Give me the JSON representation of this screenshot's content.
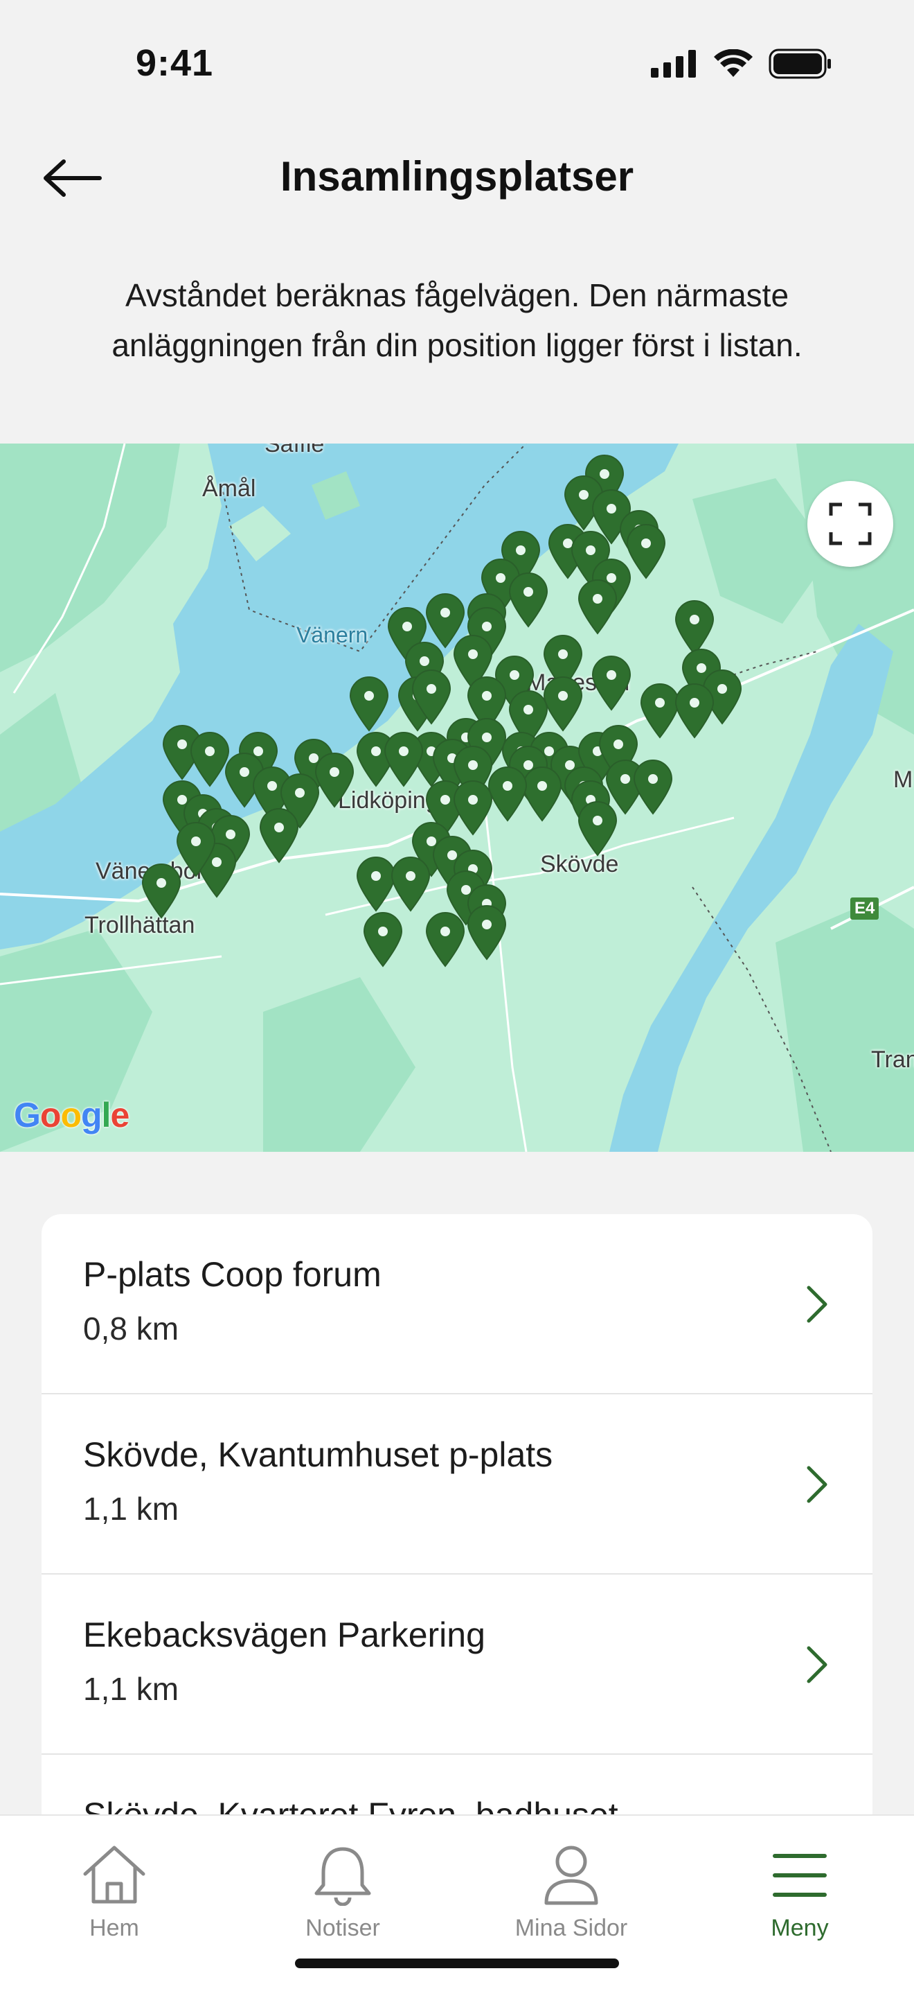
{
  "status_bar": {
    "time": "9:41"
  },
  "header": {
    "title": "Insamlingsplatser"
  },
  "intro_text": "Avståndet beräknas fågelvägen. Den närmaste anläggningen från din position ligger först i listan.",
  "map": {
    "labels": {
      "saffle": "Säffle",
      "amal": "Åmål",
      "vanern": "Vänern",
      "mariestad": "Mariestad",
      "lidkoping": "Lidköping",
      "vanersborg": "Vänersborg",
      "trollhattan": "Trollhättan",
      "skovde": "Skövde",
      "m_city": "M",
      "tran": "Tran",
      "e4": "E4"
    },
    "attribution": "Google",
    "pin_color": "#2e6f2e"
  },
  "list": {
    "items": [
      {
        "name": "P-plats Coop forum",
        "distance": "0,8 km"
      },
      {
        "name": "Skövde, Kvantumhuset p-plats",
        "distance": "1,1 km"
      },
      {
        "name": "Ekebacksvägen Parkering",
        "distance": "1,1 km"
      },
      {
        "name": "Skövde, Kvarteret Fyren, badhuset",
        "distance": ""
      }
    ]
  },
  "tabs": [
    {
      "label": "Hem",
      "icon": "home-icon"
    },
    {
      "label": "Notiser",
      "icon": "bell-icon"
    },
    {
      "label": "Mina Sidor",
      "icon": "user-icon"
    },
    {
      "label": "Meny",
      "icon": "menu-icon"
    }
  ],
  "colors": {
    "accent": "#2e6b2e",
    "water": "#8fd5e8",
    "land": "#bfeed7"
  }
}
